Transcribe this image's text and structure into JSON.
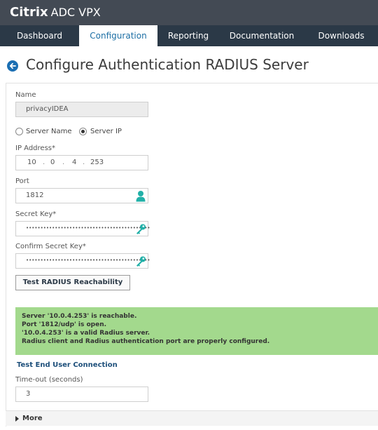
{
  "app": {
    "brand_bold": "Citrix",
    "brand_light": "ADC VPX"
  },
  "nav": {
    "tabs": [
      {
        "label": "Dashboard",
        "active": false
      },
      {
        "label": "Configuration",
        "active": true
      },
      {
        "label": "Reporting",
        "active": false
      },
      {
        "label": "Documentation",
        "active": false
      },
      {
        "label": "Downloads",
        "active": false
      }
    ]
  },
  "page": {
    "title": "Configure Authentication RADIUS Server"
  },
  "form": {
    "name_label": "Name",
    "name_value": "privacyIDEA",
    "radio_server_name": "Server Name",
    "radio_server_ip": "Server IP",
    "radio_selected": "Server IP",
    "ip_label": "IP Address*",
    "ip_segments": [
      "10",
      "0",
      "4",
      "253"
    ],
    "port_label": "Port",
    "port_value": "1812",
    "secret_label": "Secret Key*",
    "secret_mask": "•••••••••••••••••••••••••••••••••••••••••••",
    "confirm_label": "Confirm Secret Key*",
    "confirm_mask": "•••••••••••••••••••••••••••••••••••••••••••",
    "test_button": "Test RADIUS Reachability",
    "messages": [
      "Server '10.0.4.253' is reachable.",
      "Port '1812/udp' is open.",
      "'10.0.4.253' is a valid Radius server.",
      "Radius client and Radius authentication port are properly configured."
    ],
    "test_end_user": "Test End User Connection",
    "timeout_label": "Time-out (seconds)",
    "timeout_value": "3",
    "more_label": "More"
  },
  "colors": {
    "nav_bg": "#2b3947",
    "topbar_bg": "#434a54",
    "success_bg": "#a3d98d",
    "accent": "#1d6fa5",
    "icon_teal": "#22b0a8"
  },
  "icons": {
    "back": "back-arrow-circle-icon",
    "port": "user-icon",
    "secret": "key-icon",
    "confirm": "key-icon",
    "more": "caret-right-icon"
  }
}
